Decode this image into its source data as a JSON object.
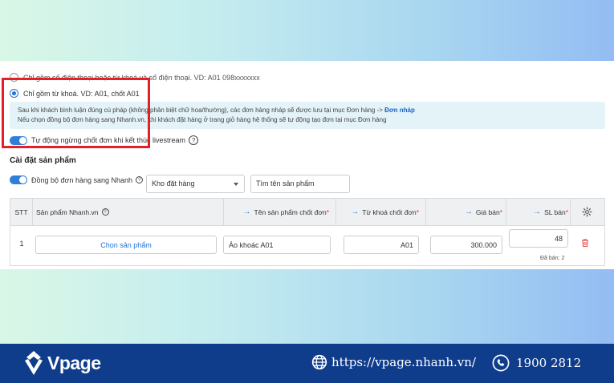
{
  "options": {
    "top_option_label": "Chỉ gồm số điện thoại hoặc từ khoá và số điện thoại. VD: A01 098xxxxxxx",
    "keyword_option_label": "Chỉ gồm từ khoá. VD: A01, chốt A01"
  },
  "info": {
    "line1_text": "Sau khi khách bình luận đúng cú pháp (không phân biệt chữ hoa/thường), các đơn hàng nháp sẽ được lưu tại mục Đơn hàng -> ",
    "line1_link": "Đơn nháp",
    "line2_text": "Nếu chọn đồng bộ đơn hàng sang Nhanh.vn, khi khách đặt hàng ở trang giỏ hàng hệ thống sẽ tự động tạo đơn tại mục Đơn hàng"
  },
  "auto_stop_label": "Tự động ngừng chốt đơn khi kết thúc livestream",
  "section_title": "Cài đặt sản phẩm",
  "sync_label": "Đồng bộ đơn hàng sang Nhanh",
  "warehouse_select": "Kho đặt hàng",
  "product_search": "Tìm tên sản phẩm",
  "table": {
    "headers": {
      "stt": "STT",
      "product": "Sản phẩm Nhanh.vn",
      "name": "Tên sản phẩm chốt đơn",
      "keyword": "Từ khoá chốt đơn",
      "price": "Giá bán",
      "qty": "SL bán"
    },
    "row": {
      "stt": "1",
      "choose_product": "Chọn sản phẩm",
      "name": "Áo khoác A01",
      "keyword": "A01",
      "price": "300.000",
      "qty": "48",
      "sold": "Đã bán: 2"
    }
  },
  "footer": {
    "brand": "Vpage",
    "website": "https://vpage.nhanh.vn/",
    "phone": "1900 2812"
  },
  "colors": {
    "accent": "#1e73d8",
    "highlight": "#e41f26",
    "footer_bg": "#0f3d8c"
  }
}
